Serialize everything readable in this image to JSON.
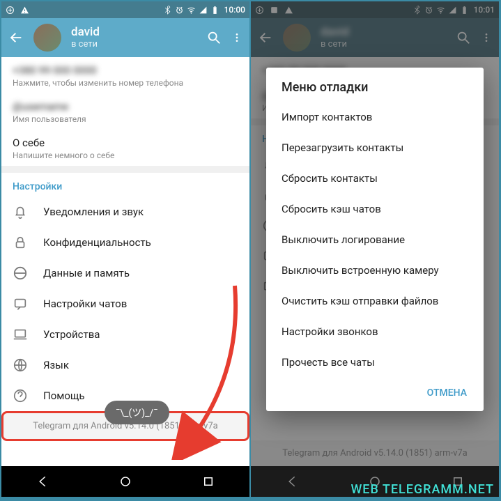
{
  "statusbar": {
    "left": {
      "time": "10:00",
      "time_right": "10:01"
    }
  },
  "toolbar": {
    "name_left": "david",
    "status_left": "в сети",
    "name_right": "david",
    "status_right": "в сети"
  },
  "profile": {
    "phone_label": "Нажмите, чтобы изменить номер телефона",
    "username_label": "Имя пользователя",
    "about_title": "О себе",
    "about_sub": "Напишите немного о себе"
  },
  "settings": {
    "header": "Настройки",
    "items": [
      "Уведомления и звук",
      "Конфиденциальность",
      "Данные и память",
      "Настройки чатов",
      "Устройства",
      "Язык",
      "Помощь"
    ]
  },
  "toast": "¯\\_(ツ)_/¯",
  "version": "Telegram для Android v5.14.0 (1851) arm-v7a",
  "dialog": {
    "title": "Меню отладки",
    "items": [
      "Импорт контактов",
      "Перезагрузить контакты",
      "Сбросить контакты",
      "Сбросить кэш чатов",
      "Выключить логирование",
      "Выключить встроенную камеру",
      "Очистить кэш отправки файлов",
      "Настройки звонков",
      "Прочесть все чаты"
    ],
    "cancel": "ОТМЕНА"
  },
  "right_settings_header": "Настройки",
  "watermark": "WEB TELEGRAMM.NET"
}
